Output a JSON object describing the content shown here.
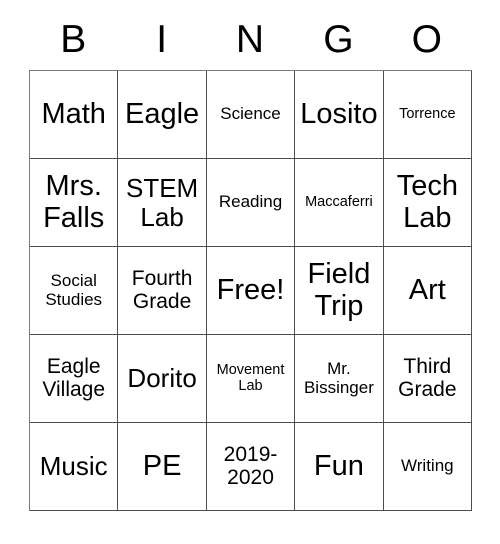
{
  "card": {
    "headers": [
      "B",
      "I",
      "N",
      "G",
      "O"
    ],
    "rows": [
      [
        {
          "text": "Math",
          "size": "fs-xl"
        },
        {
          "text": "Eagle",
          "size": "fs-xl"
        },
        {
          "text": "Science",
          "size": "fs-sm"
        },
        {
          "text": "Losito",
          "size": "fs-xl"
        },
        {
          "text": "Torrence",
          "size": "fs-xs"
        }
      ],
      [
        {
          "text": "Mrs. Falls",
          "size": "fs-xl"
        },
        {
          "text": "STEM Lab",
          "size": "fs-lg"
        },
        {
          "text": "Reading",
          "size": "fs-sm"
        },
        {
          "text": "Maccaferri",
          "size": "fs-xs"
        },
        {
          "text": "Tech Lab",
          "size": "fs-xl"
        }
      ],
      [
        {
          "text": "Social Studies",
          "size": "fs-sm"
        },
        {
          "text": "Fourth Grade",
          "size": "fs-md"
        },
        {
          "text": "Free!",
          "size": "fs-xl"
        },
        {
          "text": "Field Trip",
          "size": "fs-xl"
        },
        {
          "text": "Art",
          "size": "fs-xl"
        }
      ],
      [
        {
          "text": "Eagle Village",
          "size": "fs-md"
        },
        {
          "text": "Dorito",
          "size": "fs-lg"
        },
        {
          "text": "Movement Lab",
          "size": "fs-xs"
        },
        {
          "text": "Mr. Bissinger",
          "size": "fs-sm"
        },
        {
          "text": "Third Grade",
          "size": "fs-md"
        }
      ],
      [
        {
          "text": "Music",
          "size": "fs-lg"
        },
        {
          "text": "PE",
          "size": "fs-xl"
        },
        {
          "text": "2019-2020",
          "size": "fs-md"
        },
        {
          "text": "Fun",
          "size": "fs-xl"
        },
        {
          "text": "Writing",
          "size": "fs-sm"
        }
      ]
    ]
  }
}
